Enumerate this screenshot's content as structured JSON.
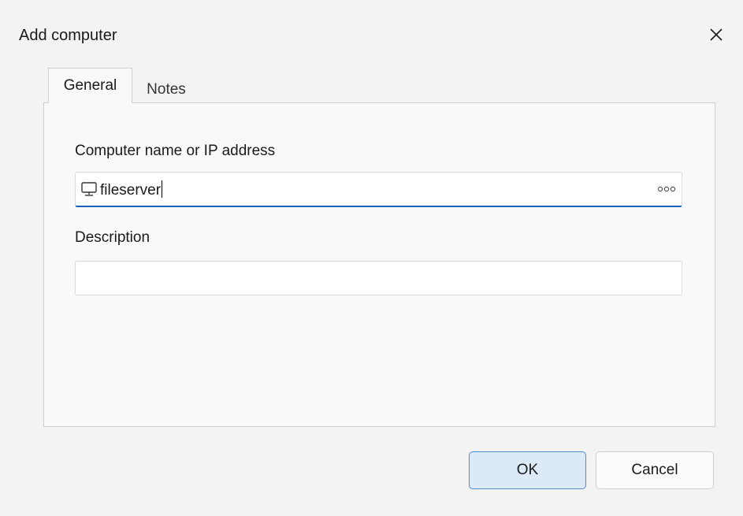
{
  "window": {
    "title": "Add computer"
  },
  "tabs": [
    {
      "label": "General",
      "selected": true
    },
    {
      "label": "Notes",
      "selected": false
    }
  ],
  "fields": {
    "name_label": "Computer name or IP address",
    "name_value": "fileserver",
    "name_icon": "monitor-icon",
    "more_icon": "more-options-icon",
    "description_label": "Description",
    "description_value": ""
  },
  "buttons": {
    "ok_label": "OK",
    "cancel_label": "Cancel"
  },
  "colors": {
    "accent": "#1a63b8",
    "ok_background": "#dce9f6"
  }
}
